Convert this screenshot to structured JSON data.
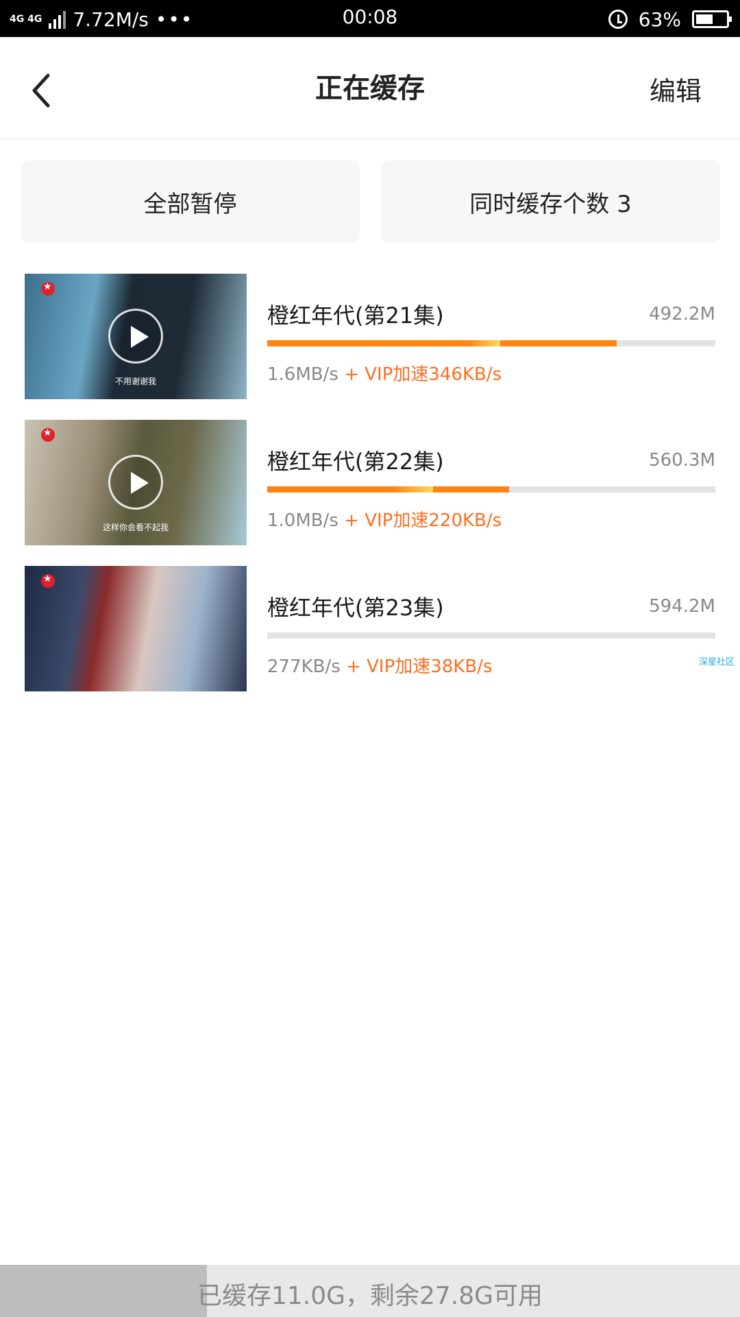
{
  "status_bar": {
    "network": "4G 4G",
    "speed": "7.72M/s",
    "dots": "•••",
    "time": "00:08",
    "battery": "63%",
    "battery_level": 0.63
  },
  "header": {
    "title": "正在缓存",
    "edit_label": "编辑",
    "back_icon": "chevron-left-icon"
  },
  "controls": {
    "pause_all_label": "全部暂停",
    "concurrent_label": "同时缓存个数 3"
  },
  "items": [
    {
      "title": "橙红年代(第21集)",
      "size": "492.2M",
      "speed": "1.6MB/s",
      "vip": "+ VIP加速346KB/s",
      "subtitle": "不用谢谢我",
      "progress": 0.78,
      "boost_start": 0.45,
      "boost_end": 0.52
    },
    {
      "title": "橙红年代(第22集)",
      "size": "560.3M",
      "speed": "1.0MB/s",
      "vip": "+ VIP加速220KB/s",
      "subtitle": "这样你会看不起我",
      "progress": 0.54,
      "boost_start": 0.28,
      "boost_end": 0.37
    },
    {
      "title": "橙红年代(第23集)",
      "size": "594.2M",
      "speed": "277KB/s",
      "vip": "+ VIP加速38KB/s",
      "subtitle": "",
      "progress": 0.0,
      "boost_start": 0.0,
      "boost_end": 0.0
    }
  ],
  "watermark": "深星社区",
  "storage": {
    "text": "已缓存11.0G，剩余27.8G可用",
    "used_fraction": 0.28
  },
  "colors": {
    "accent": "#ff8410",
    "vip": "#ff6d1f"
  }
}
